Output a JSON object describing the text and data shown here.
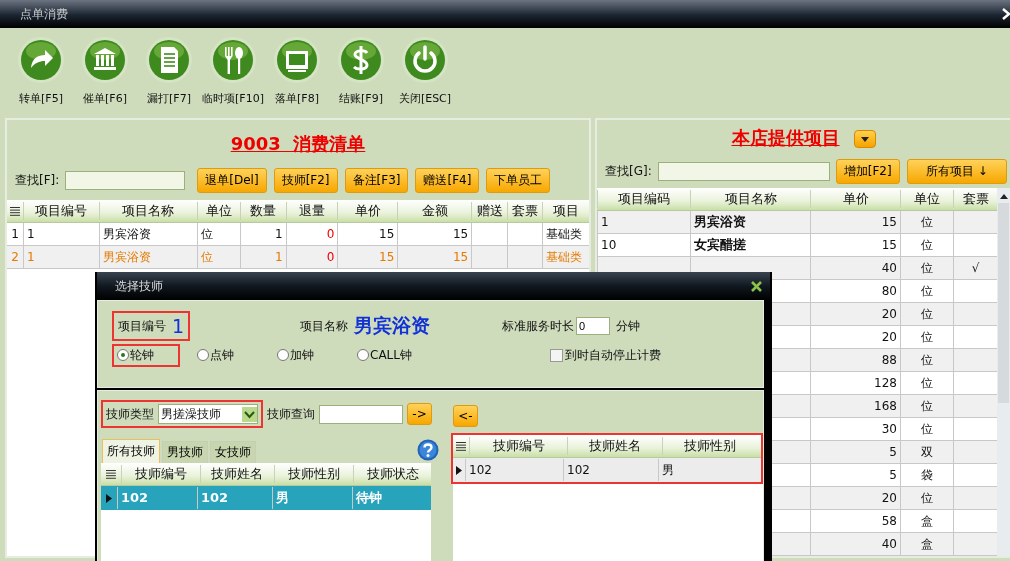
{
  "window": {
    "title": "点单消费"
  },
  "toolbar": [
    {
      "label": "转单[F5]",
      "kind": "forward"
    },
    {
      "label": "催单[F6]",
      "kind": "bank"
    },
    {
      "label": "漏打[F7]",
      "kind": "document"
    },
    {
      "label": "临时项[F10]",
      "kind": "cutlery"
    },
    {
      "label": "落单[F8]",
      "kind": "picture"
    },
    {
      "label": "结账[F9]",
      "kind": "dollar"
    },
    {
      "label": "关闭[ESC]",
      "kind": "power"
    }
  ],
  "order_panel": {
    "title": "9003  消费清单",
    "search_label": "查找[F]:",
    "buttons": [
      "退单[Del]",
      "技师[F2]",
      "备注[F3]",
      "赠送[F4]",
      "下单员工"
    ],
    "columns": [
      "项目编号",
      "项目名称",
      "单位",
      "数量",
      "退量",
      "单价",
      "金额",
      "赠送",
      "套票",
      "项目"
    ],
    "rows": [
      {
        "index": "1",
        "code": "1",
        "name": "男宾浴资",
        "unit": "位",
        "qty": "1",
        "returned": "0",
        "price": "15",
        "amount": "15",
        "category": "基础类",
        "selected": false
      },
      {
        "index": "2",
        "code": "1",
        "name": "男宾浴资",
        "unit": "位",
        "qty": "1",
        "returned": "0",
        "price": "15",
        "amount": "15",
        "category": "基础类",
        "selected": true
      }
    ]
  },
  "items_panel": {
    "title": "本店提供项目",
    "search_label": "查找[G]:",
    "buttons": [
      "增加[F2]",
      "所有项目 ↓"
    ],
    "columns": [
      "项目编码",
      "项目名称",
      "单价",
      "单位",
      "套票"
    ],
    "rows": [
      {
        "code": "1",
        "name": "男宾浴资",
        "price": "15",
        "unit": "位"
      },
      {
        "code": "10",
        "name": "女宾醋搓",
        "price": "15",
        "unit": "位"
      },
      {
        "price": "40",
        "unit": "位",
        "package": "√"
      },
      {
        "price": "80",
        "unit": "位"
      },
      {
        "price": "20",
        "unit": "位"
      },
      {
        "price": "20",
        "unit": "位"
      },
      {
        "price": "88",
        "unit": "位"
      },
      {
        "price": "128",
        "unit": "位"
      },
      {
        "price": "168",
        "unit": "位"
      },
      {
        "price": "30",
        "unit": "位"
      },
      {
        "price": "5",
        "unit": "双"
      },
      {
        "price": "5",
        "unit": "袋"
      },
      {
        "price": "20",
        "unit": "位"
      },
      {
        "price": "58",
        "unit": "盒"
      },
      {
        "price": "40",
        "unit": "盒"
      }
    ]
  },
  "dialog": {
    "title": "选择技师",
    "item_no_label": "项目编号",
    "item_no": "1",
    "item_no_highlighted": true,
    "item_name_label": "项目名称",
    "item_name": "男宾浴资",
    "duration_label": "标准服务时长",
    "duration": "0",
    "duration_unit": "分钟",
    "modes": [
      {
        "label": "轮钟",
        "selected": true,
        "highlighted": true
      },
      {
        "label": "点钟",
        "selected": false,
        "highlighted": false
      },
      {
        "label": "加钟",
        "selected": false,
        "highlighted": false
      },
      {
        "label": "CALL钟",
        "selected": false,
        "highlighted": false
      }
    ],
    "auto_stop": {
      "label": "到时自动停止计费",
      "checked": false
    },
    "type_label": "技师类型",
    "type_value": "男搓澡技师",
    "type_highlighted": true,
    "query_label": "技师查询",
    "add_button": "->",
    "remove_button": "<-",
    "tabs": [
      {
        "label": "所有技师",
        "selected": true
      },
      {
        "label": "男技师",
        "selected": false
      },
      {
        "label": "女技师",
        "selected": false
      }
    ],
    "available": {
      "columns": [
        "技师编号",
        "技师姓名",
        "技师性别",
        "技师状态"
      ],
      "rows": [
        {
          "no": "102",
          "name": "102",
          "gender": "男",
          "status": "待钟",
          "selected": true
        }
      ]
    },
    "chosen": {
      "highlighted": true,
      "columns": [
        "技师编号",
        "技师姓名",
        "技师性别"
      ],
      "rows": [
        {
          "no": "102",
          "name": "102",
          "gender": "男",
          "selected": false
        }
      ]
    }
  }
}
